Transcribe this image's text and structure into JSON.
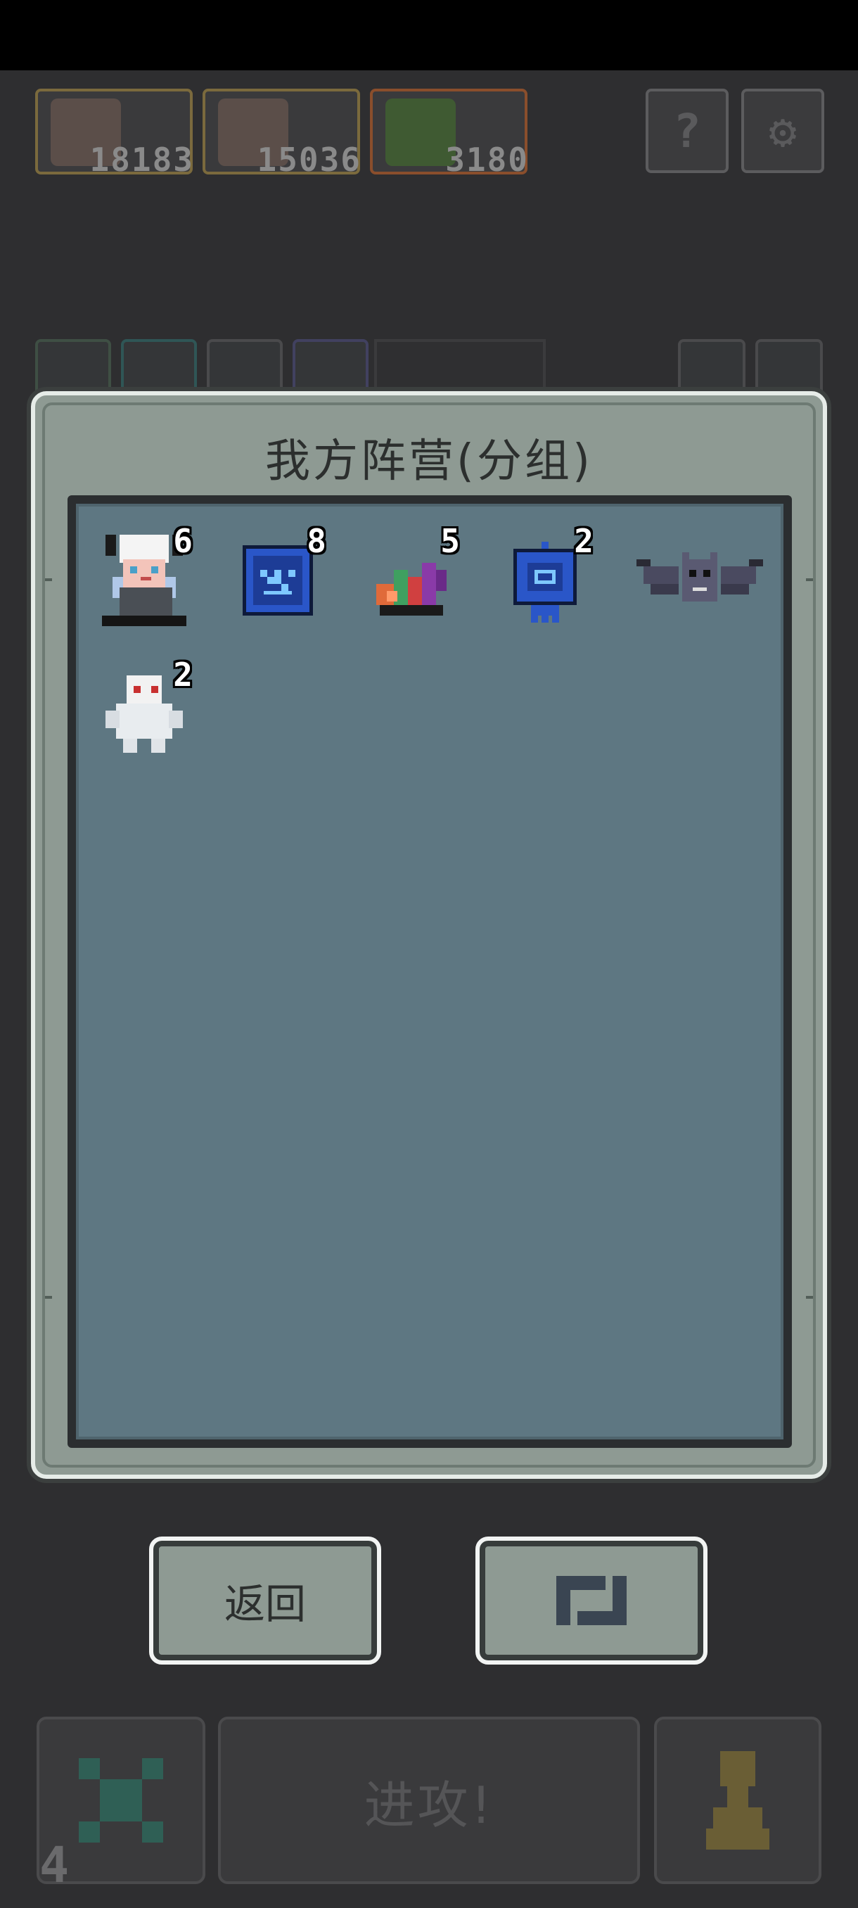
{
  "resources": [
    {
      "icon": "hero-portrait-icon",
      "value": "18183"
    },
    {
      "icon": "hero-portrait-icon",
      "value": "15036"
    },
    {
      "icon": "slime-icon",
      "value": "3180"
    }
  ],
  "top_buttons": {
    "help_icon": "question-icon",
    "settings_icon": "gear-icon",
    "help_glyph": "?",
    "settings_glyph": "⚙"
  },
  "modal": {
    "title": "我方阵营(分组)",
    "units": [
      {
        "name": "demon-girl",
        "count": "6"
      },
      {
        "name": "blue-rune-tome",
        "count": "8"
      },
      {
        "name": "crystal-plant",
        "count": "5"
      },
      {
        "name": "blue-skull-rune",
        "count": "2"
      },
      {
        "name": "bat",
        "count": ""
      },
      {
        "name": "white-ghost",
        "count": "2"
      }
    ],
    "back_label": "返回",
    "swap_icon": "swap-arrows-icon"
  },
  "bottom_bar": {
    "cancel_icon": "x-icon",
    "attack_label": "进攻!",
    "pawn_icon": "pawn-icon",
    "corner_number": "4"
  },
  "colors": {
    "accent_teal": "#3e8a78",
    "pawn_gold": "#8a7a40",
    "modal_bg": "#8e9a93",
    "panel_bg": "#5e7782"
  }
}
